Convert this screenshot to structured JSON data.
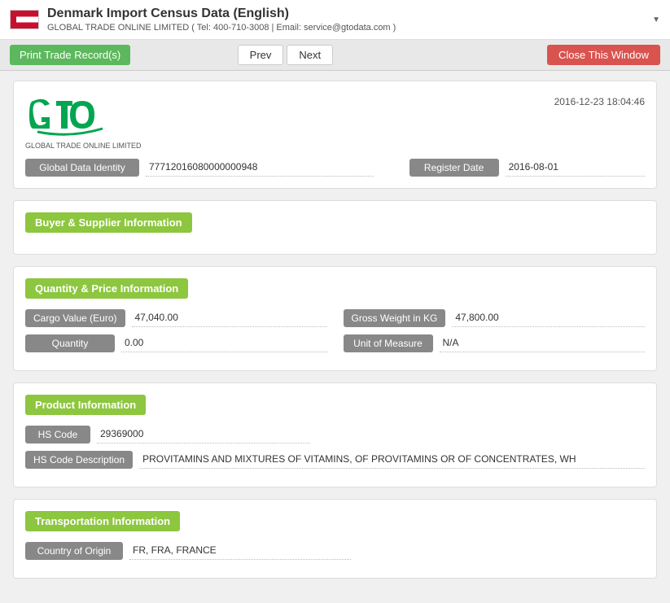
{
  "header": {
    "title": "Denmark Import Census Data (English)",
    "subtitle": "GLOBAL TRADE ONLINE LIMITED ( Tel: 400-710-3008 | Email: service@gtodata.com )",
    "logo_text": "GTO",
    "logo_subtitle": "GLOBAL TRADE ONLINE LIMITED",
    "timestamp": "2016-12-23 18:04:46"
  },
  "toolbar": {
    "print_label": "Print Trade Record(s)",
    "prev_label": "Prev",
    "next_label": "Next",
    "close_label": "Close This Window"
  },
  "global_data": {
    "identity_label": "Global Data Identity",
    "identity_value": "77712016080000000948",
    "register_date_label": "Register Date",
    "register_date_value": "2016-08-01"
  },
  "buyer_supplier": {
    "section_title": "Buyer & Supplier Information"
  },
  "quantity_price": {
    "section_title": "Quantity & Price Information",
    "cargo_value_label": "Cargo Value (Euro)",
    "cargo_value": "47,040.00",
    "gross_weight_label": "Gross Weight in KG",
    "gross_weight": "47,800.00",
    "quantity_label": "Quantity",
    "quantity_value": "0.00",
    "unit_of_measure_label": "Unit of Measure",
    "unit_of_measure_value": "N/A"
  },
  "product_info": {
    "section_title": "Product Information",
    "hs_code_label": "HS Code",
    "hs_code_value": "29369000",
    "hs_desc_label": "HS Code Description",
    "hs_desc_value": "PROVITAMINS AND MIXTURES OF VITAMINS, OF PROVITAMINS OR OF CONCENTRATES, WH"
  },
  "transportation": {
    "section_title": "Transportation Information",
    "country_origin_label": "Country of Origin",
    "country_origin_value": "FR, FRA, FRANCE"
  }
}
